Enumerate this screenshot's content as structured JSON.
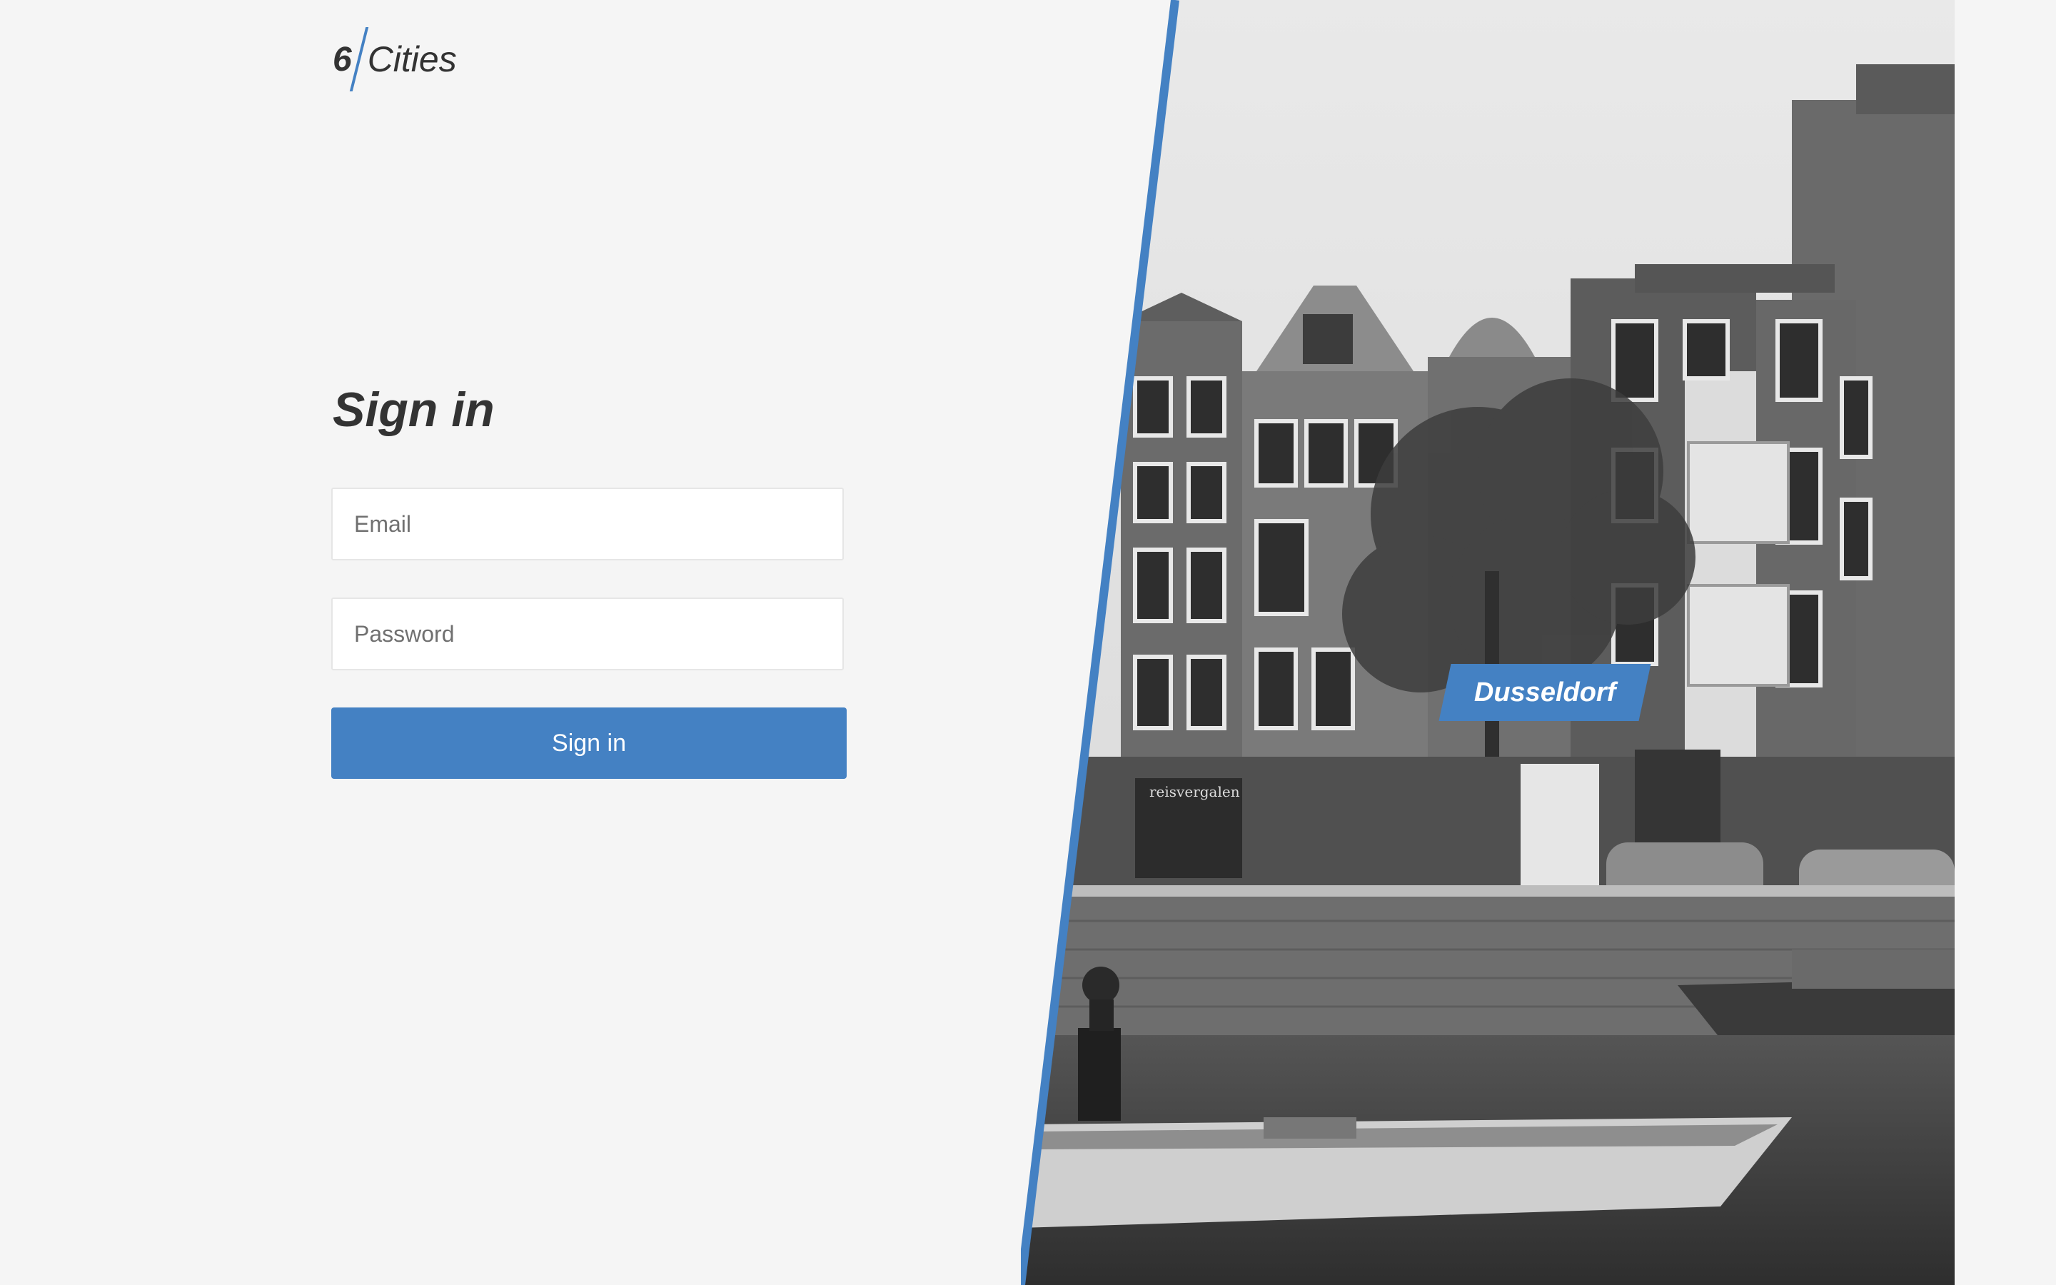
{
  "header": {
    "logo_number": "6",
    "logo_text": "Cities"
  },
  "login": {
    "title": "Sign in",
    "email_placeholder": "Email",
    "password_placeholder": "Password",
    "submit_label": "Sign in"
  },
  "city": {
    "name": "Dusseldorf"
  },
  "photo": {
    "shop_sign": "reisvergalen"
  },
  "colors": {
    "accent": "#4481c3",
    "background": "#f5f5f5",
    "text": "#333333"
  },
  "icons": {
    "logo": "logo-icon"
  }
}
